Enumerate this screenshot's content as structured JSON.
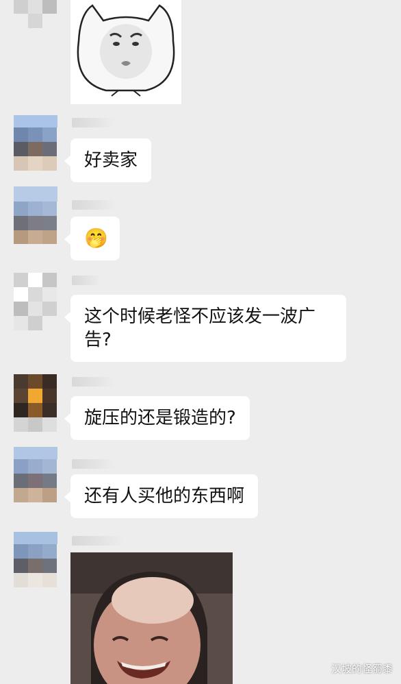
{
  "chat": {
    "messages": [
      {
        "type": "sticker",
        "desc": "cat-face-sticker"
      },
      {
        "type": "text",
        "text": "好卖家"
      },
      {
        "type": "emoji",
        "text": "🤭"
      },
      {
        "type": "text",
        "text": "这个时候老怪不应该发一波广告?"
      },
      {
        "type": "text",
        "text": "旋压的还是锻造的?"
      },
      {
        "type": "text",
        "text": "还有人买他的东西啊"
      },
      {
        "type": "sticker",
        "desc": "laughing-man-sticker"
      }
    ]
  },
  "watermark": {
    "text": "汉坡的怪蜀黍"
  }
}
